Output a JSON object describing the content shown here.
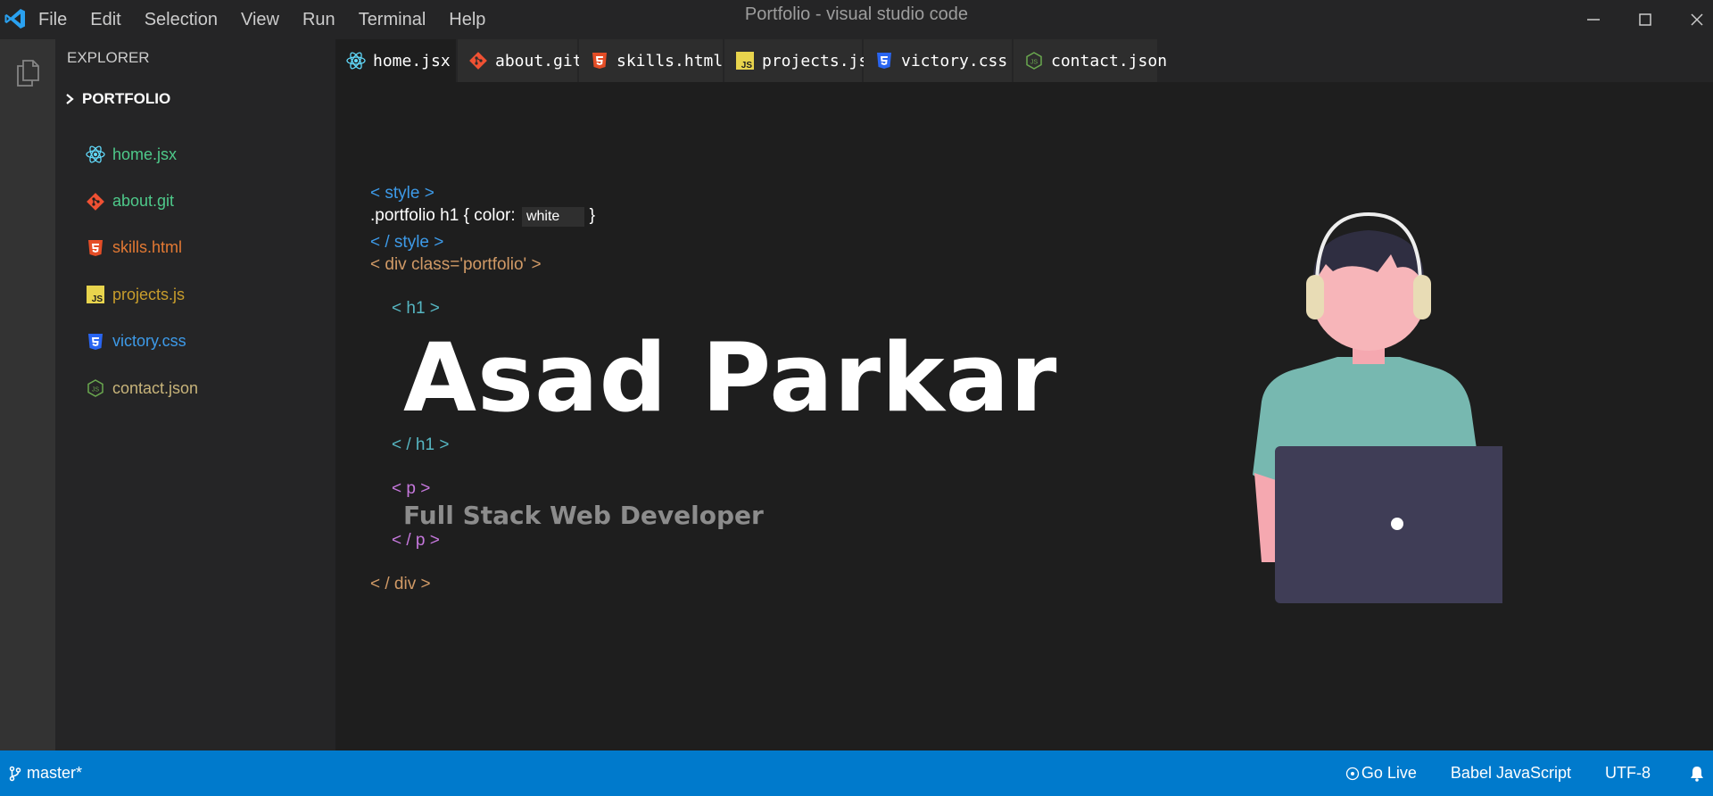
{
  "window": {
    "title": "Portfolio - visual studio code",
    "controls": {
      "minimize": "—",
      "maximize": "☐",
      "close": "✕"
    }
  },
  "menu": [
    "File",
    "Edit",
    "Selection",
    "View",
    "Run",
    "Terminal",
    "Help"
  ],
  "sidebar": {
    "title": "EXPLORER",
    "folder": "PORTFOLIO",
    "files": [
      {
        "name": "home.jsx",
        "icon": "react-icon",
        "color": "#4ec98a"
      },
      {
        "name": "about.git",
        "icon": "git-icon",
        "color": "#4ec98a"
      },
      {
        "name": "skills.html",
        "icon": "html5-icon",
        "color": "#e37933"
      },
      {
        "name": "projects.js",
        "icon": "js-icon",
        "color": "#c89d2c"
      },
      {
        "name": "victory.css",
        "icon": "css3-icon",
        "color": "#3d9ae8"
      },
      {
        "name": "contact.json",
        "icon": "node-icon",
        "color": "#c8b47a"
      }
    ]
  },
  "tabs": [
    {
      "label": "home.jsx",
      "icon": "react-icon",
      "active": true
    },
    {
      "label": "about.git",
      "icon": "git-icon"
    },
    {
      "label": "skills.html",
      "icon": "html5-icon"
    },
    {
      "label": "projects.js",
      "icon": "js-icon"
    },
    {
      "label": "victory.css",
      "icon": "css3-icon"
    },
    {
      "label": "contact.json",
      "icon": "node-icon"
    }
  ],
  "editor": {
    "style_open": "< style >",
    "css_selector": ".portfolio h1 { color:",
    "css_value": "white",
    "css_close": "}",
    "style_close": "< / style >",
    "div_open": "< div class='portfolio' >",
    "h1_open": "< h1 >",
    "name": "Asad Parkar",
    "h1_close": "< / h1 >",
    "p_open": "< p >",
    "role": "Full Stack Web Developer",
    "p_close": "< / p >",
    "div_close": "< / div >",
    "illustration": "developer-with-laptop-illustration"
  },
  "statusbar": {
    "branch": "master*",
    "go_live": "Go Live",
    "language": "Babel JavaScript",
    "encoding": "UTF-8"
  },
  "colors": {
    "accent": "#007acc",
    "editor_bg": "#1e1e1e",
    "sidebar_bg": "#252526"
  }
}
